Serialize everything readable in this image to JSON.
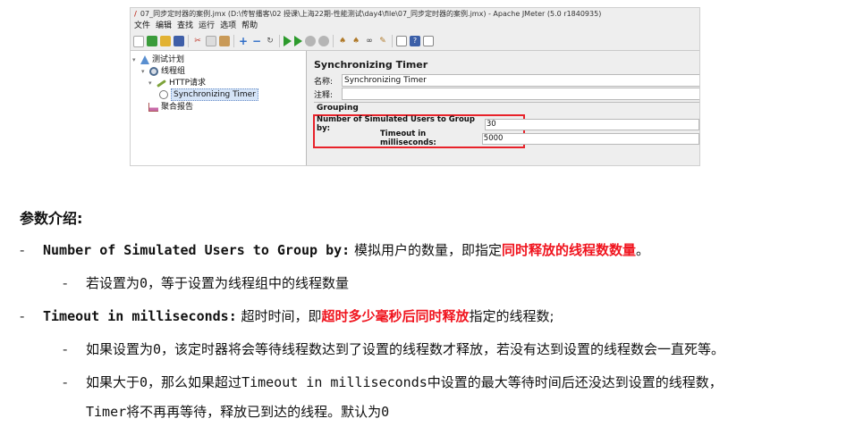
{
  "window": {
    "title": "07_同步定时器的案例.jmx (D:\\传智播客\\02 授课\\上海22期-性能测试\\day4\\file\\07_同步定时器的案例.jmx) - Apache JMeter (5.0 r1840935)"
  },
  "menu": [
    "文件",
    "编辑",
    "查找",
    "运行",
    "选项",
    "帮助"
  ],
  "tree": {
    "items": [
      {
        "label": "测试计划",
        "icon": "test-plan-icon"
      },
      {
        "label": "线程组",
        "icon": "thread-group-icon"
      },
      {
        "label": "HTTP请求",
        "icon": "http-sampler-icon"
      },
      {
        "label": "Synchronizing Timer",
        "icon": "timer-icon"
      },
      {
        "label": "聚合报告",
        "icon": "report-icon"
      }
    ]
  },
  "panel": {
    "title": "Synchronizing Timer",
    "name_label": "名称:",
    "name_value": "Synchronizing Timer",
    "comment_label": "注释:",
    "group_title": "Grouping",
    "users_label": "Number of Simulated Users to Group by:",
    "users_value": "30",
    "timeout_label": "Timeout in milliseconds:",
    "timeout_value": "5000"
  },
  "doc": {
    "heading": "参数介绍:",
    "dash": "-",
    "p1_term": "Number of Simulated Users to Group by:",
    "p1_text": " 模拟用户的数量，即指定",
    "p1_highlight": "同时释放的线程数数量",
    "p1_end": "。",
    "p1_sub_a": "若设置为",
    "p1_sub_zero": "0",
    "p1_sub_b": "，等于设置为线程组中的线程数量",
    "p2_term": "Timeout in milliseconds:",
    "p2_text": " 超时时间，即",
    "p2_highlight": "超时多少毫秒后同时释放",
    "p2_end": "指定的线程数;",
    "p2_sub1_a": "如果设置为",
    "p2_sub1_zero": "0",
    "p2_sub1_b": "，该定时器将会等待线程数达到了设置的线程数才释放，若没有达到设置的线程数会一直死等。",
    "p2_sub2_a": "如果大于",
    "p2_sub2_zero": "0",
    "p2_sub2_b": "，那么如果超过",
    "p2_sub2_mono": "Timeout in milliseconds",
    "p2_sub2_c": "中设置的最大等待时间后还没达到设置的线程数，",
    "p2_sub2_mono2": "Timer",
    "p2_sub2_d": "将不再再等待，释放已到达的线程。默认为",
    "p2_sub2_zero2": "0"
  }
}
